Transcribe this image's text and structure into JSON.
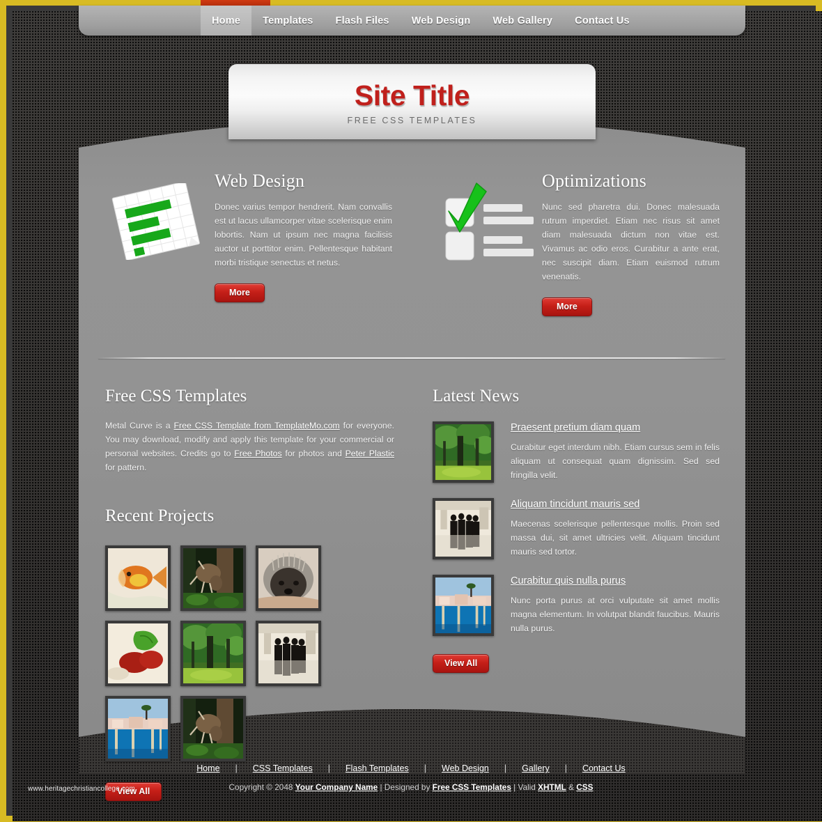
{
  "theme": {
    "frame_color": "#d8bb23",
    "accent_red": "#c0201c",
    "panel_gray": "#919191",
    "bg_dark": "#3a3836"
  },
  "nav": {
    "items": [
      {
        "label": "Home",
        "active": true
      },
      {
        "label": "Templates",
        "active": false
      },
      {
        "label": "Flash Files",
        "active": false
      },
      {
        "label": "Web Design",
        "active": false
      },
      {
        "label": "Web Gallery",
        "active": false
      },
      {
        "label": "Contact Us",
        "active": false
      }
    ]
  },
  "logo": {
    "title": "Site Title",
    "tagline": "FREE CSS TEMPLATES"
  },
  "features": [
    {
      "icon": "chart-paper-icon",
      "heading": "Web Design",
      "body": "Donec varius tempor hendrerit. Nam convallis est ut lacus ullamcorper vitae scelerisque enim lobortis. Nam ut ipsum nec magna facilisis auctor ut porttitor enim. Pellentesque habitant morbi tristique senectus et netus.",
      "button": "More"
    },
    {
      "icon": "checklist-icon",
      "heading": "Optimizations",
      "body": "Nunc sed pharetra dui. Donec malesuada rutrum imperdiet. Etiam nec risus sit amet diam malesuada dictum non vitae est. Vivamus ac odio eros. Curabitur a ante erat, nec suscipit diam. Etiam euismod rutrum venenatis.",
      "button": "More"
    }
  ],
  "about": {
    "heading": "Free CSS Templates",
    "text_1": "Metal Curve is a ",
    "link_1": "Free CSS Template from TemplateMo.com",
    "text_2": " for everyone. You may download, modify and apply this template for your commercial or personal websites. Credits go to ",
    "link_2": "Free Photos",
    "text_3": " for photos and ",
    "link_3": "Peter Plastic",
    "text_4": " for pattern."
  },
  "projects": {
    "heading": "Recent Projects",
    "view_all": "View All",
    "thumbs": [
      {
        "alt": "goldfish-photo"
      },
      {
        "alt": "deer-in-forest-photo"
      },
      {
        "alt": "pekingese-dog-photo"
      },
      {
        "alt": "strawberry-dessert-photo"
      },
      {
        "alt": "green-forest-photo"
      },
      {
        "alt": "people-silhouette-photo"
      },
      {
        "alt": "harbor-at-dusk-photo"
      },
      {
        "alt": "deer-in-forest-photo-2"
      }
    ]
  },
  "news": {
    "heading": "Latest News",
    "view_all": "View All",
    "items": [
      {
        "thumb": "green-forest-photo",
        "title": "Praesent pretium diam quam",
        "text": "Curabitur eget interdum nibh. Etiam cursus sem in felis aliquam ut consequat quam dignissim. Sed sed fringilla velit."
      },
      {
        "thumb": "people-silhouette-photo",
        "title": "Aliquam tincidunt mauris sed",
        "text": "Maecenas scelerisque pellentesque mollis. Proin sed massa dui, sit amet ultricies velit. Aliquam tincidunt mauris sed tortor."
      },
      {
        "thumb": "harbor-at-dusk-photo",
        "title": "Curabitur quis nulla purus",
        "text": "Nunc porta purus at orci vulputate sit amet mollis magna elementum. In volutpat blandit faucibus. Mauris nulla purus."
      }
    ]
  },
  "footer": {
    "links": [
      "Home",
      "CSS Templates",
      "Flash Templates",
      "Web Design",
      "Gallery",
      "Contact Us"
    ],
    "copyright_prefix": "Copyright © 2048 ",
    "company": "Your Company Name",
    "designed_by_label": " | Designed by ",
    "designer": "Free CSS Templates",
    "valid_label": " | Valid ",
    "xhtml": "XHTML",
    "amp": " & ",
    "css": "CSS"
  },
  "watermark": "www.heritagechristiancollege.com"
}
